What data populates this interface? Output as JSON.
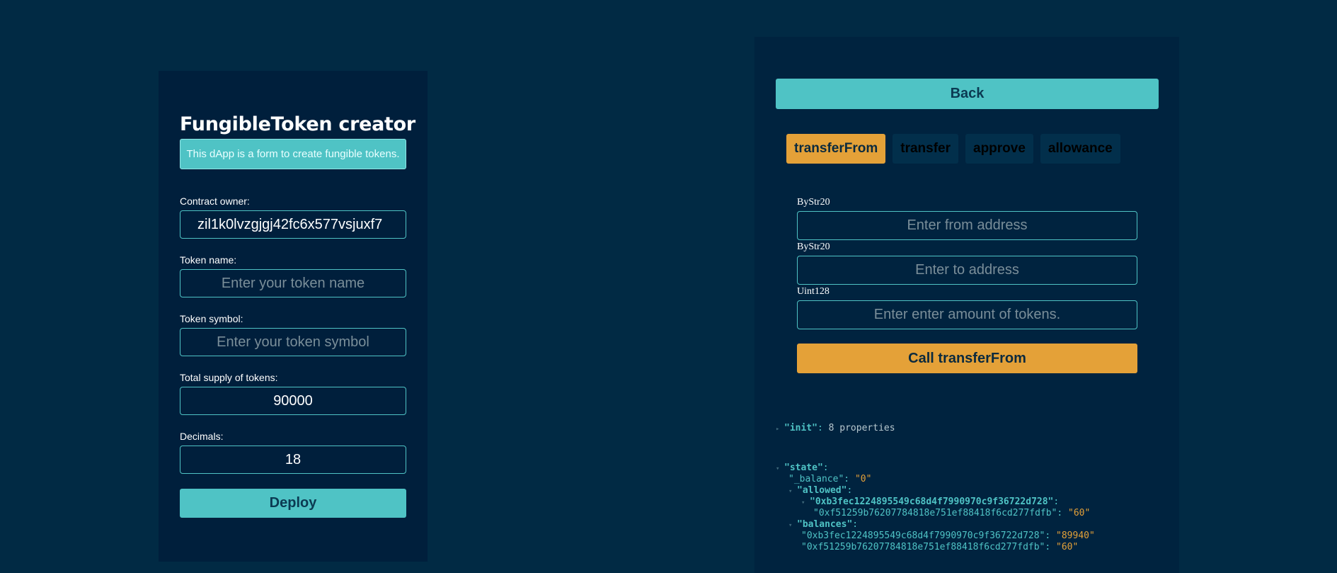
{
  "left": {
    "title": "FungibleToken creator",
    "description": "This dApp is a form to create fungible tokens.",
    "owner_label": "Contract owner:",
    "owner_value": "zil1k0lvzgjgj42fc6x577vsjuxf7",
    "token_name_label": "Token name:",
    "token_name_placeholder": "Enter your token name",
    "token_symbol_label": "Token symbol:",
    "token_symbol_placeholder": "Enter your token symbol",
    "supply_label": "Total supply of tokens:",
    "supply_value": "90000",
    "decimals_label": "Decimals:",
    "decimals_value": "18",
    "deploy_label": "Deploy"
  },
  "right": {
    "back_label": "Back",
    "tabs": [
      {
        "label": "transferFrom",
        "active": true
      },
      {
        "label": "transfer",
        "active": false
      },
      {
        "label": "approve",
        "active": false
      },
      {
        "label": "allowance",
        "active": false
      }
    ],
    "params": [
      {
        "type": "ByStr20",
        "placeholder": "Enter from address"
      },
      {
        "type": "ByStr20",
        "placeholder": "Enter to address"
      },
      {
        "type": "Uint128",
        "placeholder": "Enter enter amount of tokens."
      }
    ],
    "call_label": "Call transferFrom"
  },
  "tree": {
    "init_key": "\"init\"",
    "init_meta": "8 properties",
    "state_key": "\"state\"",
    "balance_key": "\"_balance\"",
    "balance_val": "\"0\"",
    "allowed_key": "\"allowed\"",
    "allowed_owner_key": "\"0xb3fec1224895549c68d4f7990970c9f36722d728\"",
    "allowed_spender_key": "\"0xf51259b76207784818e751ef88418f6cd277fdfb\"",
    "allowed_spender_val": "\"60\"",
    "balances_key": "\"balances\"",
    "balances_owner_key": "\"0xb3fec1224895549c68d4f7990970c9f36722d728\"",
    "balances_owner_val": "\"89940\"",
    "balances_spender_key": "\"0xf51259b76207784818e751ef88418f6cd277fdfb\"",
    "balances_spender_val": "\"60\""
  },
  "icons": {
    "collapsed": "caret-right-icon",
    "expanded": "caret-down-icon"
  },
  "colors": {
    "background": "#012a44",
    "panel": "#001f3c",
    "teal": "#4fc3c5",
    "orange": "#e4a138"
  }
}
